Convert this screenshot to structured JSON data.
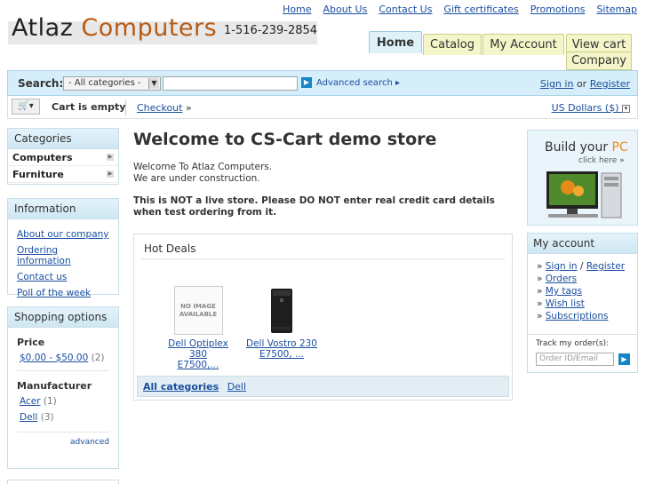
{
  "top_links": [
    "Home",
    "About Us",
    "Contact Us",
    "Gift certificates",
    "Promotions",
    "Sitemap"
  ],
  "logo": {
    "part1": "Atlaz ",
    "part2": "Computers",
    "phone": "1-516-239-2854"
  },
  "tabs": [
    "Home",
    "Catalog",
    "My Account",
    "View cart",
    "Company"
  ],
  "search": {
    "label": "Search:",
    "category_value": "- All categories -",
    "query": "",
    "advanced_label": "Advanced search",
    "sign_in": "Sign in",
    "or": "or",
    "register": "Register"
  },
  "cart": {
    "status": "Cart is empty",
    "checkout": "Checkout",
    "currency": "US Dollars ($)"
  },
  "categories": {
    "title": "Categories",
    "items": [
      "Computers",
      "Furniture"
    ]
  },
  "information": {
    "title": "Information",
    "links": [
      "About our company",
      "Ordering information",
      "Contact us",
      "Poll of the week"
    ]
  },
  "shopping_options": {
    "title": "Shopping options",
    "price_title": "Price",
    "price_range": "$0.00 - $50.00",
    "price_count": "(2)",
    "manufacturer_title": "Manufacturer",
    "manufacturers": [
      {
        "name": "Acer",
        "count": "(1)"
      },
      {
        "name": "Dell",
        "count": "(3)"
      }
    ],
    "advanced": "advanced"
  },
  "main": {
    "welcome": "Welcome to CS-Cart demo store",
    "intro_line1": "Welcome To Atlaz Computers.",
    "intro_line2": "We are under construction.",
    "warning": "This is NOT a live store. Please DO NOT enter real credit card details when test ordering from it."
  },
  "hot_deals": {
    "title": "Hot Deals",
    "products": [
      {
        "name_line1": "Dell Optiplex 380",
        "name_line2": "E7500,...",
        "image_text": "NO IMAGE AVAILABLE"
      },
      {
        "name_line1": "Dell Vostro 230",
        "name_line2": "E7500, ..."
      }
    ],
    "footer_all": "All categories",
    "footer_dell": "Dell"
  },
  "banner": {
    "line1": "Build your ",
    "line1_pc": "PC",
    "line2": "click here »"
  },
  "my_account": {
    "title": "My account",
    "sign_in": "Sign in",
    "slash": "/",
    "register": "Register",
    "links": [
      "Orders",
      "My tags",
      "Wish list",
      "Subscriptions"
    ],
    "track_label": "Track my order(s):",
    "track_placeholder": "Order ID/Email"
  },
  "colors": {
    "link": "#1a4fa0",
    "accent_orange": "#b75a14",
    "header_blue": "#d6eef9",
    "tab_yellow": "#f4f5c8",
    "go_button": "#1585c8"
  }
}
